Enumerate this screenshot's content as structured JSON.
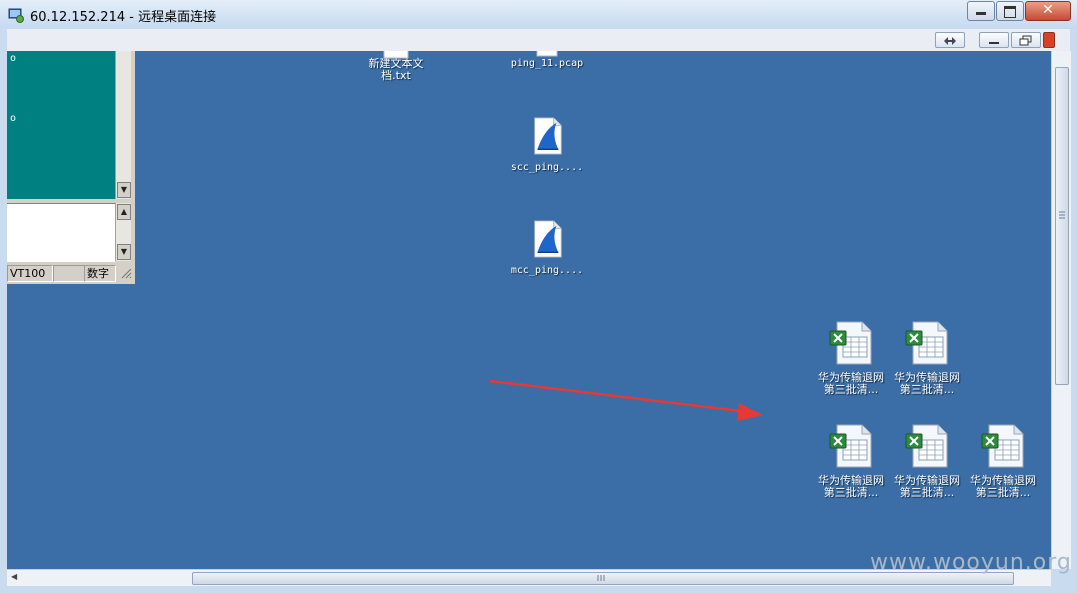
{
  "window": {
    "title": "60.12.152.214 - 远程桌面连接",
    "close_glyph": "✕"
  },
  "terminal": {
    "screen_lines": [
      "o",
      "o"
    ],
    "status": [
      "VT100",
      "",
      "数字"
    ]
  },
  "desktop_icons": [
    {
      "label_line1": "新建文本文",
      "label_line2": "档.txt",
      "icon": "text-file-icon"
    },
    {
      "label_line1": "ping_11.pcap",
      "label_line2": "",
      "icon": "pcap-file-icon"
    },
    {
      "label_line1": "scc_ping....",
      "label_line2": "",
      "icon": "wireshark-file-icon"
    },
    {
      "label_line1": "mcc_ping....",
      "label_line2": "",
      "icon": "wireshark-file-icon"
    },
    {
      "label_line1": "华为传输退网",
      "label_line2": "第三批清...",
      "icon": "excel-file-icon"
    },
    {
      "label_line1": "华为传输退网",
      "label_line2": "第三批清...",
      "icon": "excel-file-icon"
    },
    {
      "label_line1": "华为传输退网",
      "label_line2": "第三批清...",
      "icon": "excel-file-icon"
    },
    {
      "label_line1": "华为传输退网",
      "label_line2": "第三批清...",
      "icon": "excel-file-icon"
    },
    {
      "label_line1": "华为传输退网",
      "label_line2": "第三批清...",
      "icon": "excel-file-icon"
    }
  ],
  "watermark": "www.wooyun.org",
  "colors": {
    "desktop": "#3b6ea6",
    "annotation_arrow": "#e53935"
  }
}
